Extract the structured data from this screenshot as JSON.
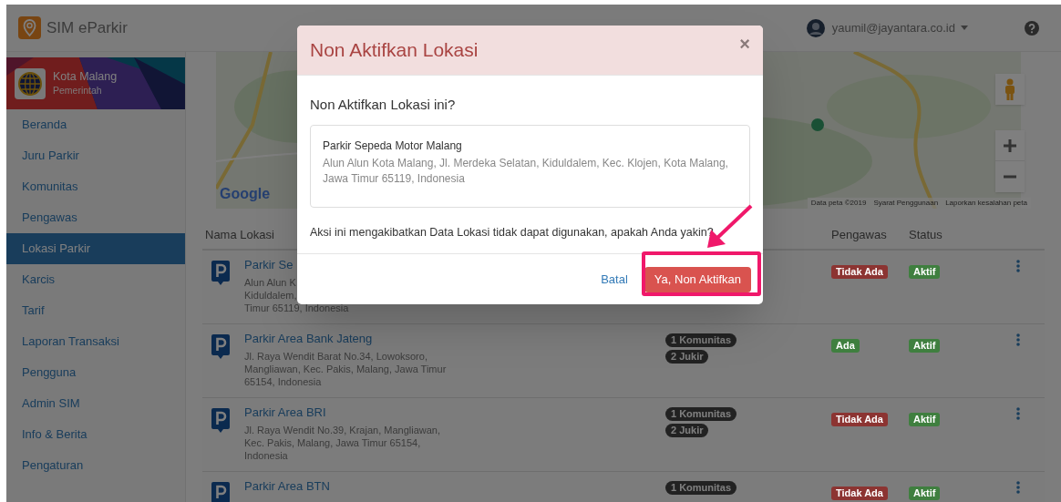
{
  "app": {
    "title": "SIM eParkir"
  },
  "user": {
    "email": "yaumil@jayantara.co.id"
  },
  "profile": {
    "name": "Kota Malang",
    "role": "Pemerintah"
  },
  "sidebar": {
    "items": [
      {
        "label": "Beranda",
        "selected": false
      },
      {
        "label": "Juru Parkir",
        "selected": false
      },
      {
        "label": "Komunitas",
        "selected": false
      },
      {
        "label": "Pengawas",
        "selected": false
      },
      {
        "label": "Lokasi Parkir",
        "selected": true
      },
      {
        "label": "Karcis",
        "selected": false
      },
      {
        "label": "Tarif",
        "selected": false
      },
      {
        "label": "Laporan Transaksi",
        "selected": false
      },
      {
        "label": "Pengguna",
        "selected": false
      },
      {
        "label": "Admin SIM",
        "selected": false
      },
      {
        "label": "Info & Berita",
        "selected": false
      },
      {
        "label": "Pengaturan",
        "selected": false
      }
    ]
  },
  "map": {
    "kind": "picture",
    "logo": "Google",
    "attribution": [
      "Data peta ©2019",
      "Syarat Penggunaan",
      "Laporkan kesalahan peta"
    ]
  },
  "table": {
    "headers": {
      "name": "Nama Lokasi",
      "pengawas": "Pengawas",
      "status": "Status"
    },
    "rows": [
      {
        "name": "Parkir Se",
        "address_lines": [
          "Alun Alun K",
          "Kiduldalem,",
          "Timur 65119, Indonesia"
        ],
        "pengawas": {
          "text": "Tidak Ada",
          "color": "#8c3432"
        },
        "status": {
          "text": "Aktif",
          "color": "#3f7f3f"
        }
      },
      {
        "name": "Parkir Area Bank Jateng",
        "address_lines": [
          "Jl. Raya Wendit Barat No.34, Lowoksoro,",
          "Mangliawan, Kec. Pakis, Malang, Jawa Timur",
          "65154, Indonesia"
        ],
        "tags": [
          "1 Komunitas",
          "2 Jukir"
        ],
        "pengawas": {
          "text": "Ada",
          "color": "#3f7f3f"
        },
        "status": {
          "text": "Aktif",
          "color": "#3f7f3f"
        }
      },
      {
        "name": "Parkir Area BRI",
        "address_lines": [
          "Jl. Raya Wendit No.39, Krajan, Mangliawan,",
          "Kec. Pakis, Malang, Jawa Timur 65154,",
          "Indonesia"
        ],
        "tags": [
          "1 Komunitas",
          "2 Jukir"
        ],
        "pengawas": {
          "text": "Tidak Ada",
          "color": "#8c3432"
        },
        "status": {
          "text": "Aktif",
          "color": "#3f7f3f"
        }
      },
      {
        "name": "Parkir Area BTN",
        "tags": [
          "1 Komunitas"
        ],
        "pengawas": {
          "text": "Tidak Ada",
          "color": "#8c3432"
        },
        "status": {
          "text": "Aktif",
          "color": "#3f7f3f"
        }
      }
    ]
  },
  "modal": {
    "title": "Non Aktifkan Lokasi",
    "close": "×",
    "question": "Non Aktifkan Lokasi ini?",
    "location": {
      "name": "Parkir Sepeda Motor Malang",
      "address": "Alun Alun Kota Malang, Jl. Merdeka Selatan, Kiduldalem, Kec. Klojen, Kota Malang, Jawa Timur 65119, Indonesia"
    },
    "warning": "Aksi ini mengakibatkan Data Lokasi tidak dapat digunakan, apakah Anda yakin?",
    "cancel": "Batal",
    "confirm": "Ya, Non Aktifkan"
  }
}
